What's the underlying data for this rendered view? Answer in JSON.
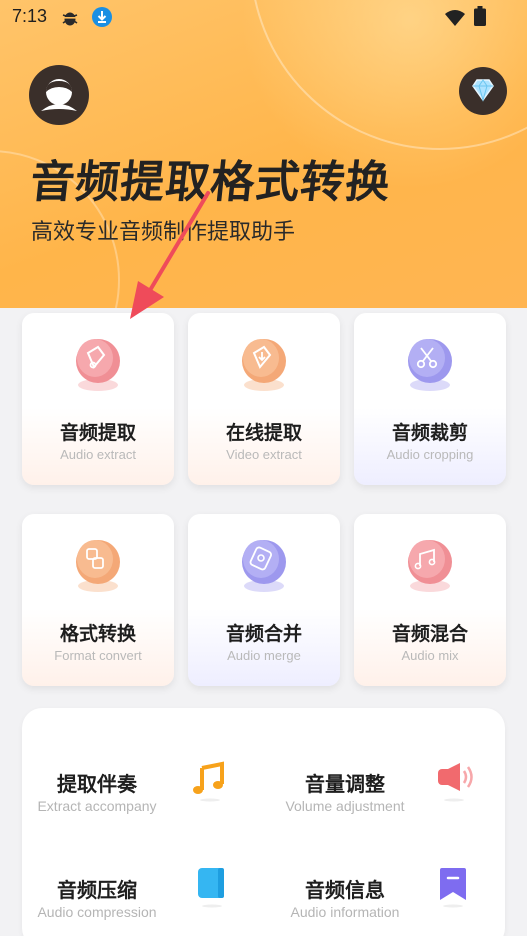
{
  "status_bar": {
    "time": "7:13",
    "icons": [
      "bug-icon",
      "download-icon",
      "wifi-icon",
      "battery-icon"
    ]
  },
  "header": {
    "title": "音频提取格式转换",
    "subtitle": "高效专业音频制作提取助手",
    "avatar_icon": "user-avatar-icon",
    "vip_icon": "diamond-icon"
  },
  "colors": {
    "hero_bg": "#ffb54a",
    "coin_red": "#f08f95",
    "coin_orange": "#f4a877",
    "coin_purple": "#9d98ee",
    "music_orange": "#f7a21b",
    "speaker_red": "#f16a6e",
    "book_blue": "#35b6f2",
    "info_purple": "#7e6cf0"
  },
  "cards": [
    {
      "cn": "音频提取",
      "en": "Audio extract",
      "icon": "audio-extract-icon"
    },
    {
      "cn": "在线提取",
      "en": "Video extract",
      "icon": "video-extract-icon"
    },
    {
      "cn": "音频裁剪",
      "en": "Audio cropping",
      "icon": "scissors-icon"
    },
    {
      "cn": "格式转换",
      "en": "Format convert",
      "icon": "format-convert-icon"
    },
    {
      "cn": "音频合并",
      "en": "Audio merge",
      "icon": "audio-merge-icon"
    },
    {
      "cn": "音频混合",
      "en": "Audio mix",
      "icon": "audio-mix-icon"
    }
  ],
  "tools": [
    {
      "cn": "提取伴奏",
      "en": "Extract accompany",
      "icon": "music-note-icon"
    },
    {
      "cn": "音量调整",
      "en": "Volume adjustment",
      "icon": "speaker-icon"
    },
    {
      "cn": "音频压缩",
      "en": "Audio compression",
      "icon": "book-icon"
    },
    {
      "cn": "音频信息",
      "en": "Audio information",
      "icon": "bookmark-info-icon"
    }
  ]
}
